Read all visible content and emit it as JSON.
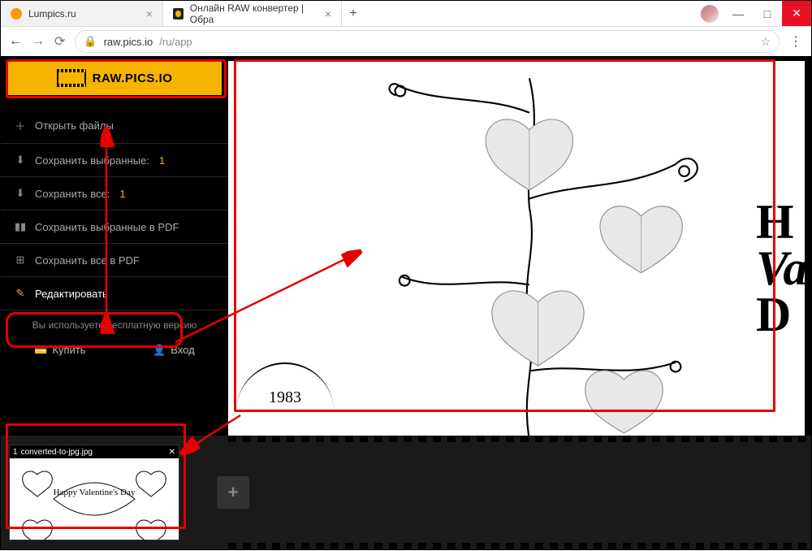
{
  "window": {
    "minimize": "—",
    "maximize": "□",
    "close_label": "✕"
  },
  "tabs": [
    {
      "title": "Lumpics.ru",
      "icon": "orange"
    },
    {
      "title": "Онлайн RAW конвертер | Обра",
      "icon": "raw"
    }
  ],
  "newtab": "+",
  "toolbar": {
    "url_host": "raw.pics.io",
    "url_path": "/ru/app",
    "back": "←",
    "forward": "→",
    "reload": "⟳",
    "star": "☆",
    "menu": "⋮"
  },
  "logo": "RAW.PICS.IO",
  "sidebar": {
    "items": [
      {
        "icon": "＋",
        "label": "Открыть файлы"
      },
      {
        "icon": "⬇",
        "label": "Сохранить выбранные:",
        "count": "1"
      },
      {
        "icon": "⬇",
        "label": "Сохранить все:",
        "count": "1"
      },
      {
        "icon": "▮▮",
        "label": "Сохранить выбранные в PDF"
      },
      {
        "icon": "⊞",
        "label": "Сохранить все в PDF"
      },
      {
        "icon": "✎",
        "label": "Редактировать"
      }
    ],
    "free_note": "Вы используете бесплатную версию",
    "buy": "Купить",
    "login": "Вход"
  },
  "canvas": {
    "year": "1983",
    "script1": "H",
    "script2": "Val",
    "script3": "D"
  },
  "filmstrip": {
    "thumb_index": "1",
    "thumb_name": "converted-to-jpg.jpg",
    "thumb_close": "✕",
    "thumb_caption": "Happy Valentine's Day",
    "add": "+"
  }
}
